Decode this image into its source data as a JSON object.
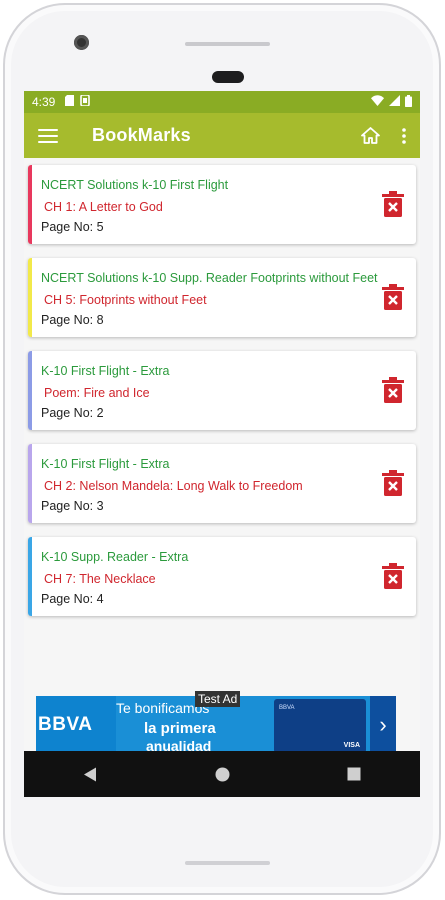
{
  "status_bar": {
    "time": "4:39"
  },
  "app_bar": {
    "title": "BookMarks"
  },
  "bookmarks": [
    {
      "book": "NCERT Solutions k-10 First Flight",
      "chapter": "CH 1: A Letter to God",
      "page": "Page No: 5",
      "accent": "#e8385d"
    },
    {
      "book": "NCERT Solutions k-10 Supp. Reader Footprints without Feet",
      "chapter": "CH 5: Footprints without Feet",
      "page": "Page No: 8",
      "accent": "#f2e94a"
    },
    {
      "book": "K-10 First Flight - Extra",
      "chapter": "Poem: Fire and Ice",
      "page": "Page No: 2",
      "accent": "#8c9be6"
    },
    {
      "book": "K-10 First Flight - Extra",
      "chapter": "CH 2: Nelson Mandela: Long Walk to Freedom",
      "page": "Page No: 3",
      "accent": "#b9a6ec"
    },
    {
      "book": "K-10 Supp. Reader - Extra",
      "chapter": "CH 7: The Necklace",
      "page": "Page No: 4",
      "accent": "#3aa6e6"
    }
  ],
  "ad": {
    "badge": "Test Ad",
    "logo": "BBVA",
    "line1": "Te bonificamos",
    "line2": "la primera",
    "line3": "anualidad",
    "card_label": "BBVA",
    "card_brand": "VISA"
  },
  "colors": {
    "status_bar": "#8aac24",
    "app_bar": "#a6bb2d",
    "book_text": "#2b9a3c",
    "chapter_text": "#d0262e",
    "delete_icon": "#d0262e"
  },
  "icons": {
    "menu": "hamburger-menu-icon",
    "home": "home-icon",
    "more": "more-vert-icon",
    "delete": "delete-icon",
    "back": "nav-back-icon",
    "home_nav": "nav-home-icon",
    "recents": "nav-recents-icon"
  }
}
